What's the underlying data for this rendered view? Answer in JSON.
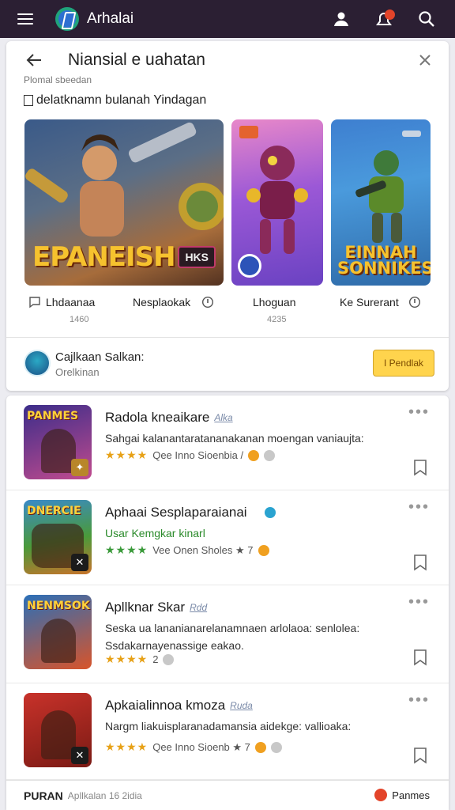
{
  "appbar": {
    "brand": "Arhalai",
    "menu_icon": "hamburger-menu-icon",
    "icons": [
      "account-icon",
      "notifications-icon",
      "search-icon"
    ]
  },
  "panel": {
    "title": "Niansial e uahatan",
    "subtitle": "Plomal sbeedan",
    "checkbox_label": "delatknamn bulanah Yindagan",
    "banners": [
      {
        "art_text": "EPANEISH",
        "tag": "HKS"
      },
      {
        "art_text": ""
      },
      {
        "art_text": "EINNAH SONNIKES"
      }
    ],
    "captions": [
      {
        "title": "Lhdaanaa",
        "sub": "1460"
      },
      {
        "title": "Nesplaokak",
        "sub": ""
      },
      {
        "title": "Lhoguan",
        "sub": "4235"
      },
      {
        "title": "Ke Surerant",
        "sub": ""
      }
    ],
    "footer": {
      "title": "Cajlkaan Salkan:",
      "sub": "Orelkinan",
      "button": "I Pendlak"
    }
  },
  "apps": [
    {
      "thumb_text": "PANMES",
      "title": "Radola kneaikare",
      "chip": "Alka",
      "desc": "Sahgai kalanantaratananakanan moengan vaniaujta:",
      "meta": "Qee Inno Sioenbia /",
      "rating_stars": "★★★★",
      "colors": [
        "#3b2d8a",
        "#c14b8e"
      ]
    },
    {
      "thumb_text": "DNERCIE",
      "title": "Aphaai Sesplaparaianai",
      "chip": "",
      "desc": "Usar Kemgkar kinarl",
      "meta": "Vee Onen Sholes ★ 7",
      "rating_stars": "★★★★",
      "colors": [
        "#4a9a3a",
        "#c8732a"
      ]
    },
    {
      "thumb_text": "NENMSOK",
      "title": "Apllknar Skar",
      "chip": "Rdd",
      "desc": "Seska ua lananianarelanamnaen arlolaoa: senlolea: Ssdakarnayenassige eakao.",
      "meta": "2",
      "rating_stars": "★★★★",
      "colors": [
        "#2a6fb8",
        "#d8542a"
      ]
    },
    {
      "thumb_text": "",
      "title": "Apkaialinnoa kmoza",
      "chip": "Ruda",
      "desc": "Nargm liakuisplaranadamansia aidekge: vallioaka:",
      "meta": "Qee Inno Sioenb ★ 7",
      "rating_stars": "★★★★",
      "colors": [
        "#c8322a",
        "#7a1a14"
      ]
    }
  ],
  "bottombar": {
    "strong": "PURAN",
    "text": "Apllkalan 16 2idia",
    "right": "Panmes"
  }
}
